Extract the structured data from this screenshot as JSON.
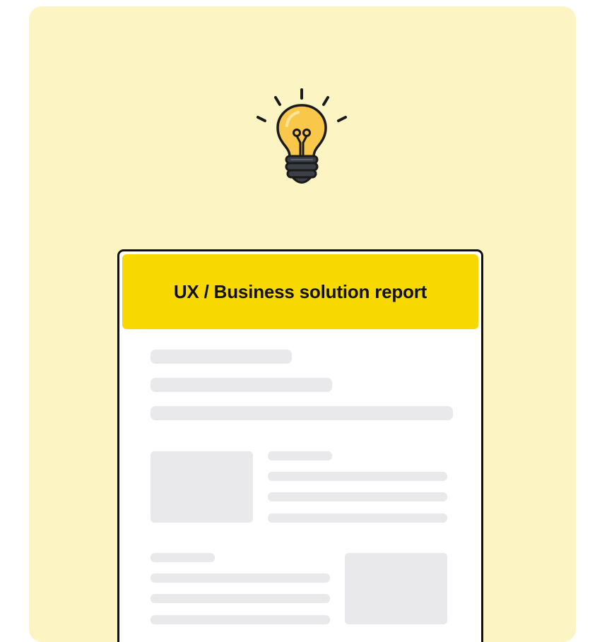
{
  "report": {
    "title": "UX / Business solution report"
  },
  "colors": {
    "panel_background": "#fdf4c4",
    "header_accent": "#f7d800",
    "bulb_glass": "#f9c84a",
    "bulb_base": "#3b3f47",
    "placeholder": "#e9e9ec"
  },
  "icons": {
    "idea": "lightbulb-icon"
  }
}
